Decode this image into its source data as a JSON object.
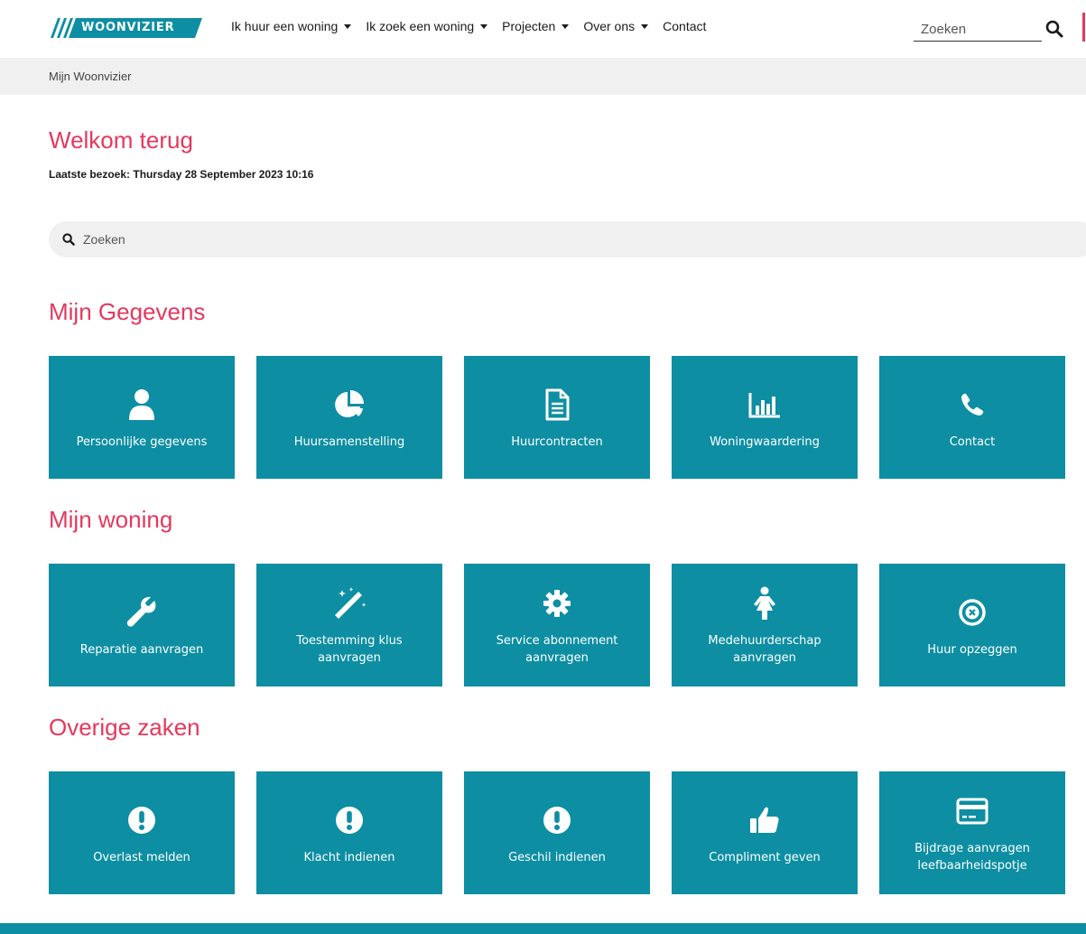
{
  "header": {
    "logo_text": "WOONVIZIER",
    "nav": [
      {
        "label": "Ik huur een woning",
        "has_dropdown": true
      },
      {
        "label": "Ik zoek een woning",
        "has_dropdown": true
      },
      {
        "label": "Projecten",
        "has_dropdown": true
      },
      {
        "label": "Over ons",
        "has_dropdown": true
      },
      {
        "label": "Contact",
        "has_dropdown": false
      }
    ],
    "search_placeholder": "Zoeken",
    "search_icon": "search-icon"
  },
  "breadcrumb": {
    "current": "Mijn Woonvizier"
  },
  "welcome": {
    "title": "Welkom terug",
    "last_visit": "Laatste bezoek: Thursday 28 September 2023 10:16"
  },
  "search": {
    "placeholder": "Zoeken"
  },
  "colors": {
    "accent": "#e5385e",
    "tile": "#0d8ea3",
    "breadcrumb_bg": "#f0f0f0"
  },
  "sections": [
    {
      "title": "Mijn Gegevens",
      "tiles": [
        {
          "label": "Persoonlijke gegevens",
          "icon": "user-icon"
        },
        {
          "label": "Huursamenstelling",
          "icon": "pie-chart-icon"
        },
        {
          "label": "Huurcontracten",
          "icon": "document-icon"
        },
        {
          "label": "Woningwaardering",
          "icon": "bar-chart-icon"
        },
        {
          "label": "Contact",
          "icon": "phone-icon"
        }
      ]
    },
    {
      "title": "Mijn woning",
      "tiles": [
        {
          "label": "Reparatie aanvragen",
          "icon": "wrench-icon"
        },
        {
          "label": "Toestemming klus aanvragen",
          "icon": "magic-wand-icon"
        },
        {
          "label": "Service abonnement aanvragen",
          "icon": "gear-icon"
        },
        {
          "label": "Medehuurderschap aanvragen",
          "icon": "person-icon"
        },
        {
          "label": "Huur opzeggen",
          "icon": "cancel-circle-icon"
        }
      ]
    },
    {
      "title": "Overige zaken",
      "tiles": [
        {
          "label": "Overlast melden",
          "icon": "exclamation-circle-icon"
        },
        {
          "label": "Klacht indienen",
          "icon": "exclamation-circle-icon"
        },
        {
          "label": "Geschil indienen",
          "icon": "exclamation-circle-icon"
        },
        {
          "label": "Compliment geven",
          "icon": "thumbs-up-icon"
        },
        {
          "label": "Bijdrage aanvragen leefbaarheidspotje",
          "icon": "credit-card-icon"
        }
      ]
    }
  ]
}
